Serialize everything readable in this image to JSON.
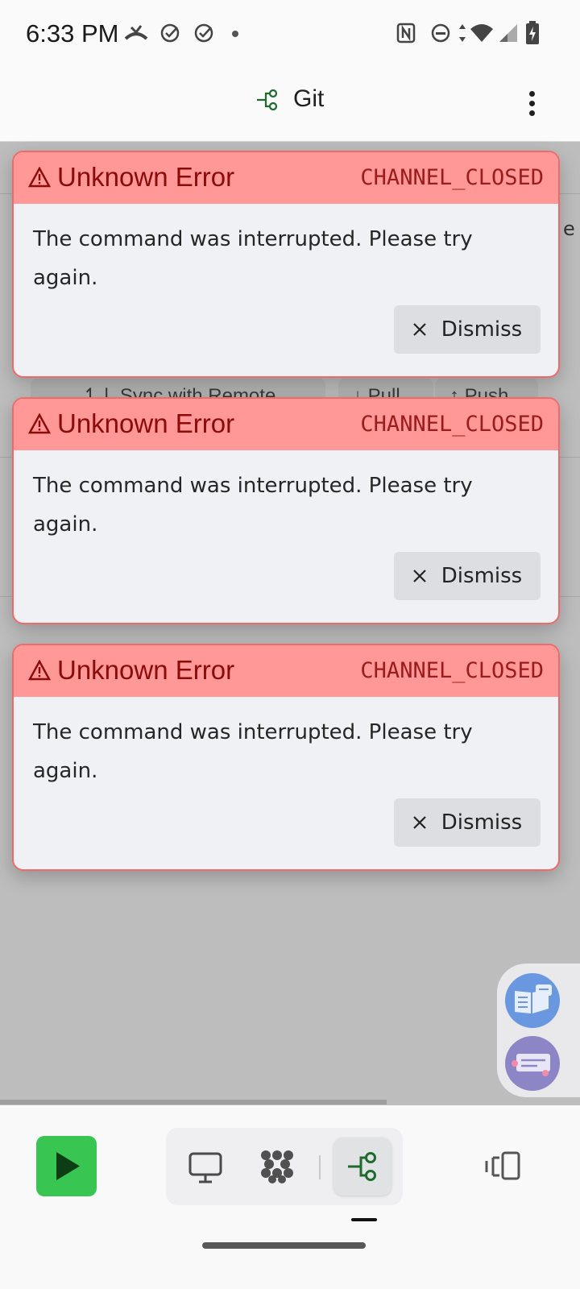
{
  "status_bar": {
    "time": "6:33 PM",
    "left_icons": [
      "missed-call-icon",
      "check-circle-icon",
      "check-circle-icon",
      "dot-icon"
    ],
    "right_icons": [
      "nfc-icon",
      "do-not-disturb-icon",
      "data-arrows-icon",
      "wifi-icon",
      "signal-icon",
      "battery-charging-icon"
    ]
  },
  "topbar": {
    "title": "Git",
    "title_icon": "git-branch-icon",
    "menu_icon": "more-vert-icon"
  },
  "background": {
    "partial_letter": "e",
    "sync_label": "Sync with Remote",
    "pull_label": "Pull",
    "push_label": "Push"
  },
  "toasts": [
    {
      "title": "Unknown Error",
      "code": "CHANNEL_CLOSED",
      "message": "The command was interrupted. Please try again.",
      "dismiss_label": "Dismiss"
    },
    {
      "title": "Unknown Error",
      "code": "CHANNEL_CLOSED",
      "message": "The command was interrupted. Please try again.",
      "dismiss_label": "Dismiss"
    },
    {
      "title": "Unknown Error",
      "code": "CHANNEL_CLOSED",
      "message": "The command was interrupted. Please try again.",
      "dismiss_label": "Dismiss"
    }
  ],
  "floating_actions": [
    {
      "icon": "docs-book-icon",
      "color": "#6a98e0"
    },
    {
      "icon": "chat-feedback-icon",
      "color": "#8c86c6"
    }
  ],
  "bottom_bar": {
    "run_icon": "play-icon",
    "run_color": "#39c552",
    "tabs": [
      {
        "icon": "monitor-icon",
        "active": false
      },
      {
        "icon": "grid-dots-icon",
        "active": false
      },
      {
        "icon": "git-branch-icon",
        "active": true
      }
    ],
    "panel_icon": "side-panel-icon"
  },
  "colors": {
    "error_header": "#ff9896",
    "error_text": "#8b0a0a",
    "toast_border": "#ef6b6b",
    "git_green": "#1f6a2e"
  }
}
